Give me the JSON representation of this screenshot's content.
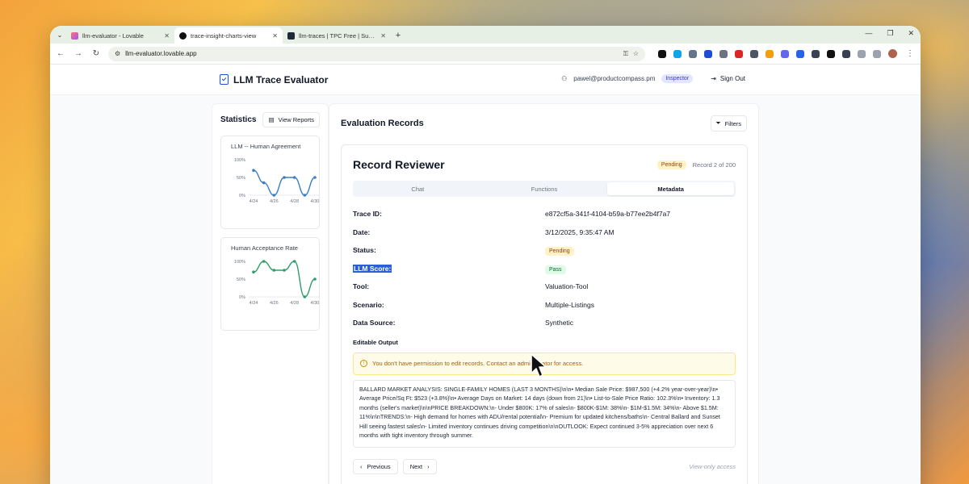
{
  "browser": {
    "tabs": [
      {
        "label": "llm-evaluator - Lovable",
        "color": "#e0665c"
      },
      {
        "label": "trace-insight-charts-view",
        "color": "#1f2937"
      },
      {
        "label": "llm-traces | TPC Free | Supabase",
        "color": "#1f2937"
      }
    ],
    "url": "llm-evaluator.lovable.app"
  },
  "header": {
    "brand": "LLM Trace Evaluator",
    "user_email": "pawel@productcompass.pm",
    "role": "Inspector",
    "sign_out": "Sign Out"
  },
  "stats": {
    "title": "Statistics",
    "view_reports": "View Reports",
    "agreement_chart": {
      "title": "LLM -- Human Agreement",
      "color": "#3b7fc4",
      "y_ticks": [
        "100%",
        "50%",
        "0%"
      ],
      "x_ticks": [
        "4/24",
        "4/26",
        "4/28",
        "4/30"
      ],
      "values": [
        70,
        35,
        0,
        50,
        50,
        0,
        50
      ]
    },
    "acceptance_chart": {
      "title": "Human Acceptance Rate",
      "color": "#2f9e6b",
      "y_ticks": [
        "100%",
        "50%",
        "0%"
      ],
      "x_ticks": [
        "4/24",
        "4/26",
        "4/28",
        "4/30"
      ],
      "values": [
        70,
        100,
        75,
        75,
        100,
        0,
        50
      ]
    }
  },
  "main": {
    "title": "Evaluation Records",
    "filters": "Filters",
    "record": {
      "title": "Record Reviewer",
      "status_badge": "Pending",
      "position": "Record 2 of 200",
      "tabs": [
        "Chat",
        "Functions",
        "Metadata"
      ],
      "fields": {
        "trace_id_label": "Trace ID:",
        "trace_id": "e872cf5a-341f-4104-b59a-b77ee2b4f7a7",
        "date_label": "Date:",
        "date": "3/12/2025, 9:35:47 AM",
        "status_label": "Status:",
        "status": "Pending",
        "llm_score_label": "LLM Score:",
        "llm_score": "Pass",
        "tool_label": "Tool:",
        "tool": "Valuation-Tool",
        "scenario_label": "Scenario:",
        "scenario": "Multiple-Listings",
        "data_source_label": "Data Source:",
        "data_source": "Synthetic"
      },
      "editable_label": "Editable Output",
      "warning": "You don't have permission to edit records. Contact an administrator for access.",
      "output": "BALLARD MARKET ANALYSIS: SINGLE-FAMILY HOMES (LAST 3 MONTHS)\\n\\n• Median Sale Price: $987,500 (+4.2% year-over-year)\\n• Average Price/Sq Ft: $523 (+3.8%)\\n• Average Days on Market: 14 days (down from 21)\\n• List-to-Sale Price Ratio: 102.3%\\n• Inventory: 1.3 months (seller's market)\\n\\nPRICE BREAKDOWN:\\n- Under $800K: 17% of sales\\n- $800K-$1M: 38%\\n- $1M-$1.5M: 34%\\n- Above $1.5M: 11%\\n\\nTRENDS:\\n- High demand for homes with ADU/rental potential\\n- Premium for updated kitchens/baths\\n- Central Ballard and Sunset Hill seeing fastest sales\\n- Limited inventory continues driving competition\\n\\nOUTLOOK: Expect continued 3-5% appreciation over next 6 months with tight inventory through summer.",
      "previous": "Previous",
      "next": "Next",
      "view_only": "View-only access"
    }
  }
}
